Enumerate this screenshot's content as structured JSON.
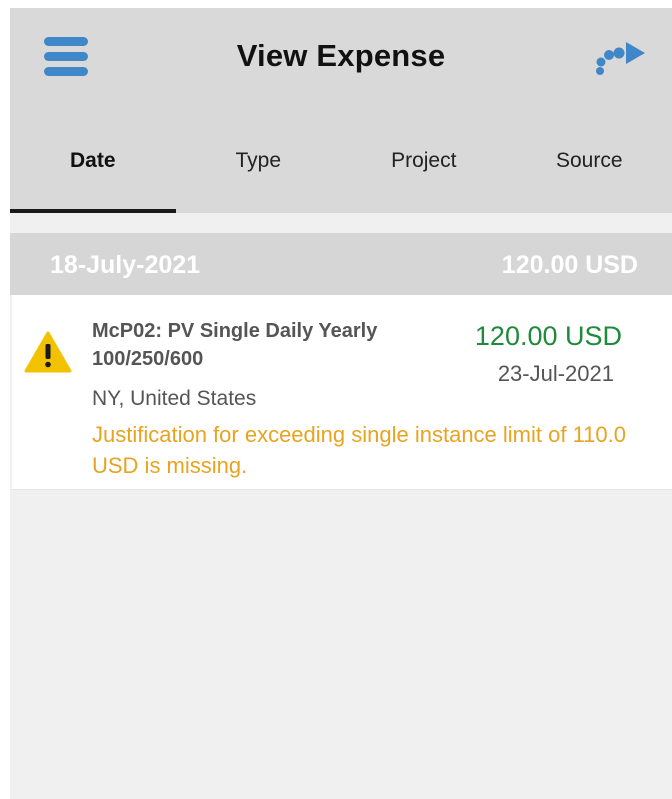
{
  "header": {
    "title": "View Expense",
    "menu_icon": "hamburger-menu-icon",
    "forward_icon": "dotted-forward-arrow-icon"
  },
  "tabs": [
    {
      "label": "Date",
      "active": true
    },
    {
      "label": "Type",
      "active": false
    },
    {
      "label": "Project",
      "active": false
    },
    {
      "label": "Source",
      "active": false
    }
  ],
  "groups": [
    {
      "date": "18-July-2021",
      "total": "120.00 USD",
      "expenses": [
        {
          "name": "McP02: PV Single Daily Yearly 100/250/600",
          "amount": "120.00 USD",
          "date": "23-Jul-2021",
          "location": "NY, United States",
          "warning_icon": "warning-triangle-icon",
          "message": "Justification for exceeding single instance limit of 110.0 USD is missing."
        }
      ]
    }
  ],
  "colors": {
    "header_bg": "#d9d9d9",
    "accent_blue": "#3f87c8",
    "amount_green": "#1f8a3a",
    "warning_orange": "#e8a321",
    "warning_yellow": "#f2c200"
  }
}
